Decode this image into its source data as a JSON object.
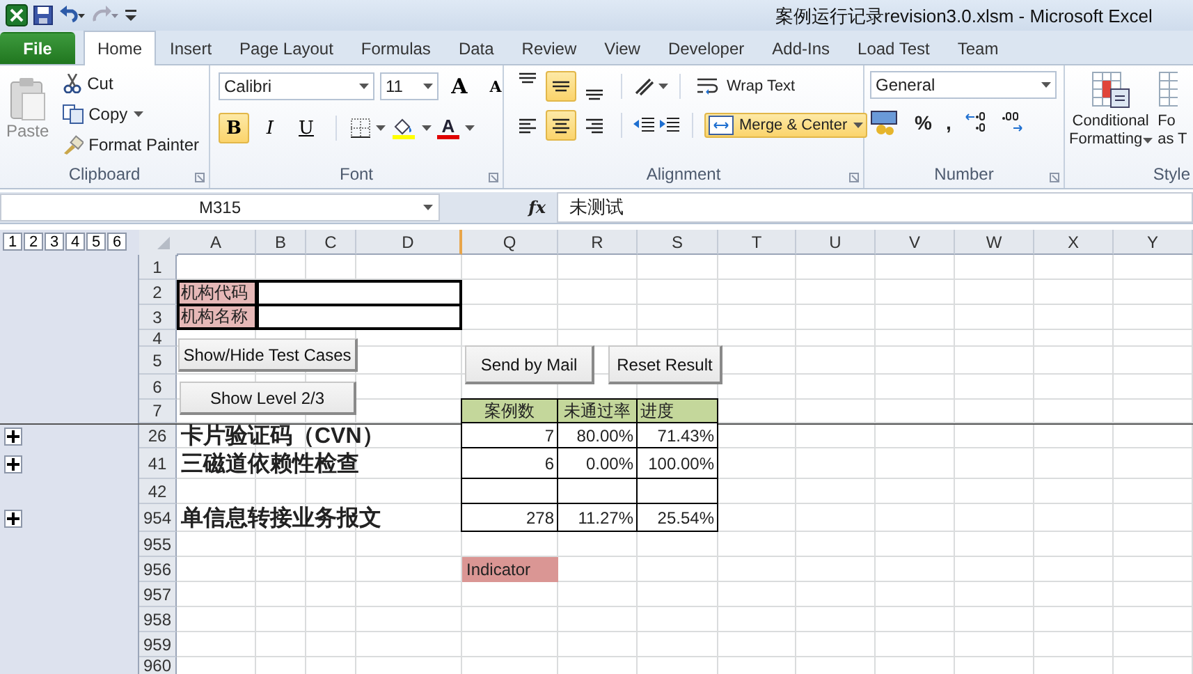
{
  "window": {
    "title": "案例运行记录revision3.0.xlsm  -  Microsoft Excel"
  },
  "tabs": [
    {
      "label": "File",
      "kind": "file",
      "selected": false
    },
    {
      "label": "Home",
      "kind": "tab",
      "selected": true
    },
    {
      "label": "Insert",
      "kind": "tab",
      "selected": false
    },
    {
      "label": "Page Layout",
      "kind": "tab",
      "selected": false
    },
    {
      "label": "Formulas",
      "kind": "tab",
      "selected": false
    },
    {
      "label": "Data",
      "kind": "tab",
      "selected": false
    },
    {
      "label": "Review",
      "kind": "tab",
      "selected": false
    },
    {
      "label": "View",
      "kind": "tab",
      "selected": false
    },
    {
      "label": "Developer",
      "kind": "tab",
      "selected": false
    },
    {
      "label": "Add-Ins",
      "kind": "tab",
      "selected": false
    },
    {
      "label": "Load Test",
      "kind": "tab",
      "selected": false
    },
    {
      "label": "Team",
      "kind": "tab",
      "selected": false
    }
  ],
  "ribbon": {
    "clipboard": {
      "paste": "Paste",
      "cut": "Cut",
      "copy": "Copy",
      "format_painter": "Format Painter",
      "label": "Clipboard"
    },
    "font": {
      "name": "Calibri",
      "size": "11",
      "grow": "A",
      "shrink": "A",
      "styles": [
        {
          "label": "B",
          "selected": true
        },
        {
          "label": "I",
          "selected": false
        },
        {
          "label": "U",
          "selected": false
        }
      ],
      "color_letter": "A",
      "label": "Font"
    },
    "alignment": {
      "vertical": [
        {
          "selected": false
        },
        {
          "selected": true
        },
        {
          "selected": false
        }
      ],
      "horizontal": [
        {
          "selected": false
        },
        {
          "selected": true
        },
        {
          "selected": false
        }
      ],
      "wrap_text": {
        "label": "Wrap Text",
        "selected": false
      },
      "merge_center": {
        "label": "Merge & Center",
        "selected": true
      },
      "label": "Alignment"
    },
    "number": {
      "format": "General",
      "percent": "%",
      "comma": ",",
      "label": "Number"
    },
    "styles": {
      "conditional": [
        "Conditional",
        "Formatting"
      ],
      "format_table": [
        "Fo",
        "as T"
      ],
      "label": "Style"
    }
  },
  "formula_bar": {
    "name_box": "M315",
    "fx": "fx",
    "content": "未测试"
  },
  "sheet": {
    "outline_levels": [
      "1",
      "2",
      "3",
      "4",
      "5",
      "6"
    ],
    "columns": [
      "A",
      "B",
      "C",
      "D",
      "Q",
      "R",
      "S",
      "T",
      "U",
      "V",
      "W",
      "X",
      "Y"
    ],
    "rows": [
      {
        "number": "1"
      },
      {
        "number": "2",
        "label": "机构代码"
      },
      {
        "number": "3",
        "label": "机构名称"
      },
      {
        "number": "4"
      },
      {
        "number": "5"
      },
      {
        "number": "6"
      },
      {
        "number": "7",
        "table_header": [
          "案例数",
          "未通过率",
          "进度"
        ]
      },
      {
        "number": "26",
        "collapsed": true,
        "title": "卡片验证码（CVN）",
        "stats": [
          "7",
          "80.00%",
          "71.43%"
        ]
      },
      {
        "number": "41",
        "collapsed": true,
        "title": "三磁道依赖性检查",
        "stats": [
          "6",
          "0.00%",
          "100.00%"
        ]
      },
      {
        "number": "42"
      },
      {
        "number": "954",
        "collapsed": true,
        "title": "单信息转接业务报文",
        "stats": [
          "278",
          "11.27%",
          "25.54%"
        ]
      },
      {
        "number": "955"
      },
      {
        "number": "956",
        "indicator": "Indicator"
      },
      {
        "number": "957"
      },
      {
        "number": "958"
      },
      {
        "number": "959"
      },
      {
        "number": "960"
      }
    ],
    "buttons": [
      "Show/Hide Test Cases",
      "Show Level 2/3",
      "Send by Mail",
      "Reset Result"
    ]
  }
}
